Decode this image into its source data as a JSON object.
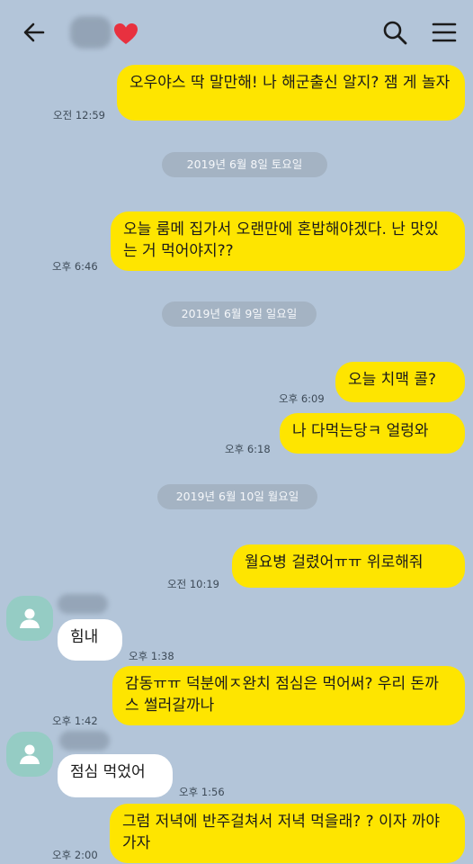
{
  "header": {
    "contact_name": "",
    "heart": "❤"
  },
  "messages": [
    {
      "text": "오우야스 딱 말만해! 나 해군출신 알지? 잼 게 놀자",
      "time": "오전 12:59"
    },
    {
      "date": "2019년 6월 8일 토요일"
    },
    {
      "text": "오늘 룸메 집가서 오랜만에 혼밥해야겠다. 난 맛있는 거 먹어야지??",
      "time": "오후 6:46"
    },
    {
      "date": "2019년 6월 9일 일요일"
    },
    {
      "text": "오늘 치맥 콜?",
      "time": "오후 6:09"
    },
    {
      "text": "나 다먹는당ㅋ 얼렁와",
      "time": "오후 6:18"
    },
    {
      "date": "2019년 6월 10일 월요일"
    },
    {
      "text": "월요병 걸렸어ㅠㅠ 위로해줘",
      "time": "오전 10:19"
    },
    {
      "text": "힘내",
      "time": "오후 1:38"
    },
    {
      "text": "감동ㅠㅠ 덕분에ㅈ완치 점심은 먹어써? 우리 돈까스 썰러갈까나",
      "time": "오후 1:42"
    },
    {
      "text": "점심 먹었어",
      "time": "오후 1:56"
    },
    {
      "text": "그럼 저녁에 반주걸쳐서 저녁 먹을래? ? 이자 까야가자",
      "time": "오후 2:00"
    }
  ],
  "colors": {
    "background": "#b3c5d9",
    "my_bubble": "#fee500",
    "their_bubble": "#ffffff"
  }
}
